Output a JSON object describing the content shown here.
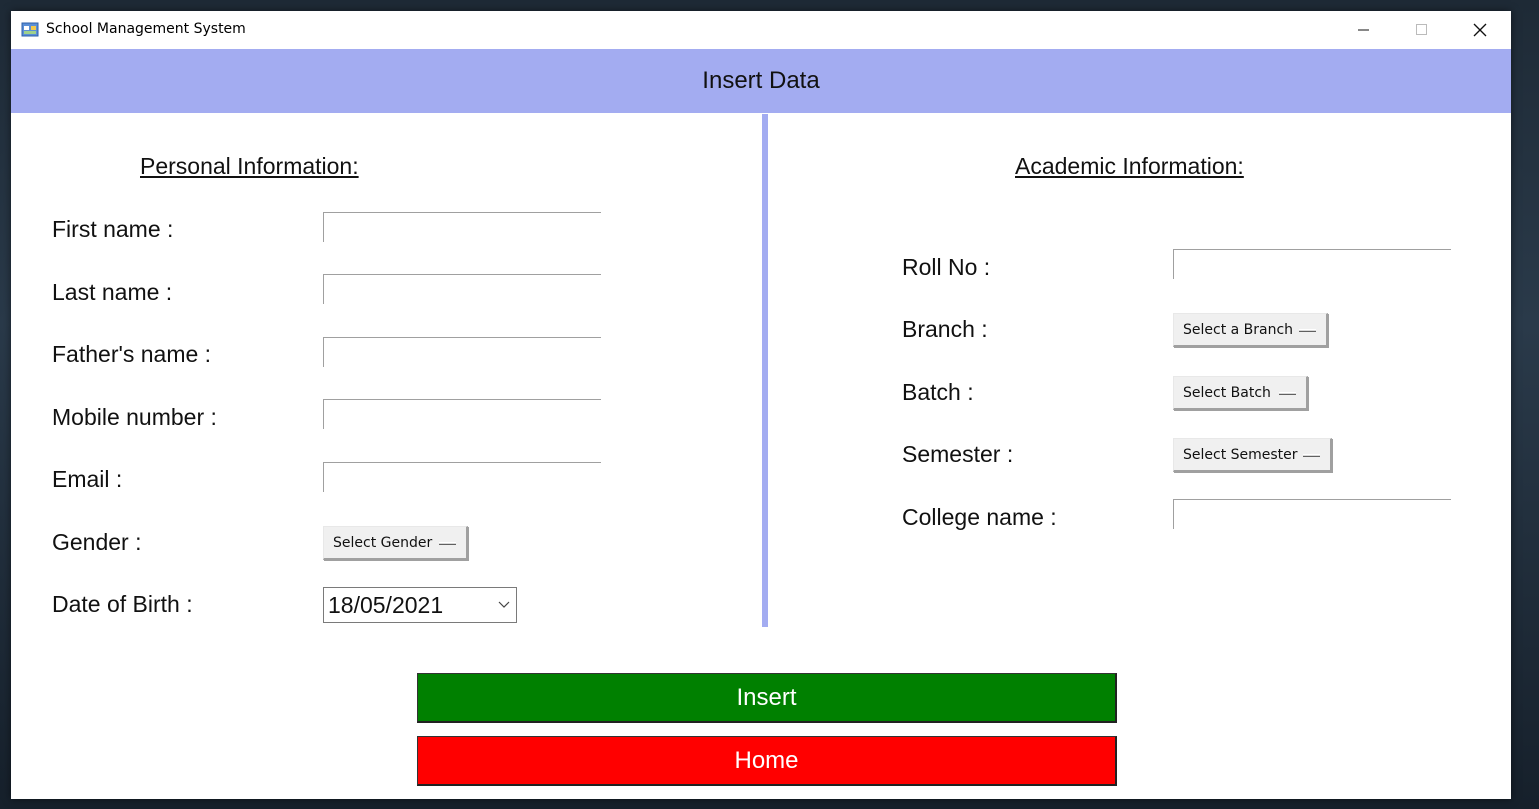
{
  "window": {
    "title": "School Management System"
  },
  "header": {
    "title": "Insert Data"
  },
  "personal": {
    "section_title": "Personal Information:",
    "first_name_label": "First name :",
    "last_name_label": "Last name :",
    "fathers_name_label": "Father's name :",
    "mobile_label": "Mobile number :",
    "email_label": "Email :",
    "gender_label": "Gender :",
    "gender_value": "Select Gender",
    "dob_label": "Date of Birth :",
    "dob_value": "18/05/2021"
  },
  "academic": {
    "section_title": "Academic Information:",
    "roll_label": "Roll No :",
    "branch_label": "Branch :",
    "branch_value": "Select a Branch",
    "batch_label": "Batch :",
    "batch_value": "Select Batch",
    "semester_label": "Semester :",
    "semester_value": "Select Semester",
    "college_label": "College name :"
  },
  "actions": {
    "insert_label": "Insert",
    "home_label": "Home"
  },
  "colors": {
    "header_bg": "#a3acf1",
    "insert_bg": "#008000",
    "home_bg": "#ff0000"
  }
}
